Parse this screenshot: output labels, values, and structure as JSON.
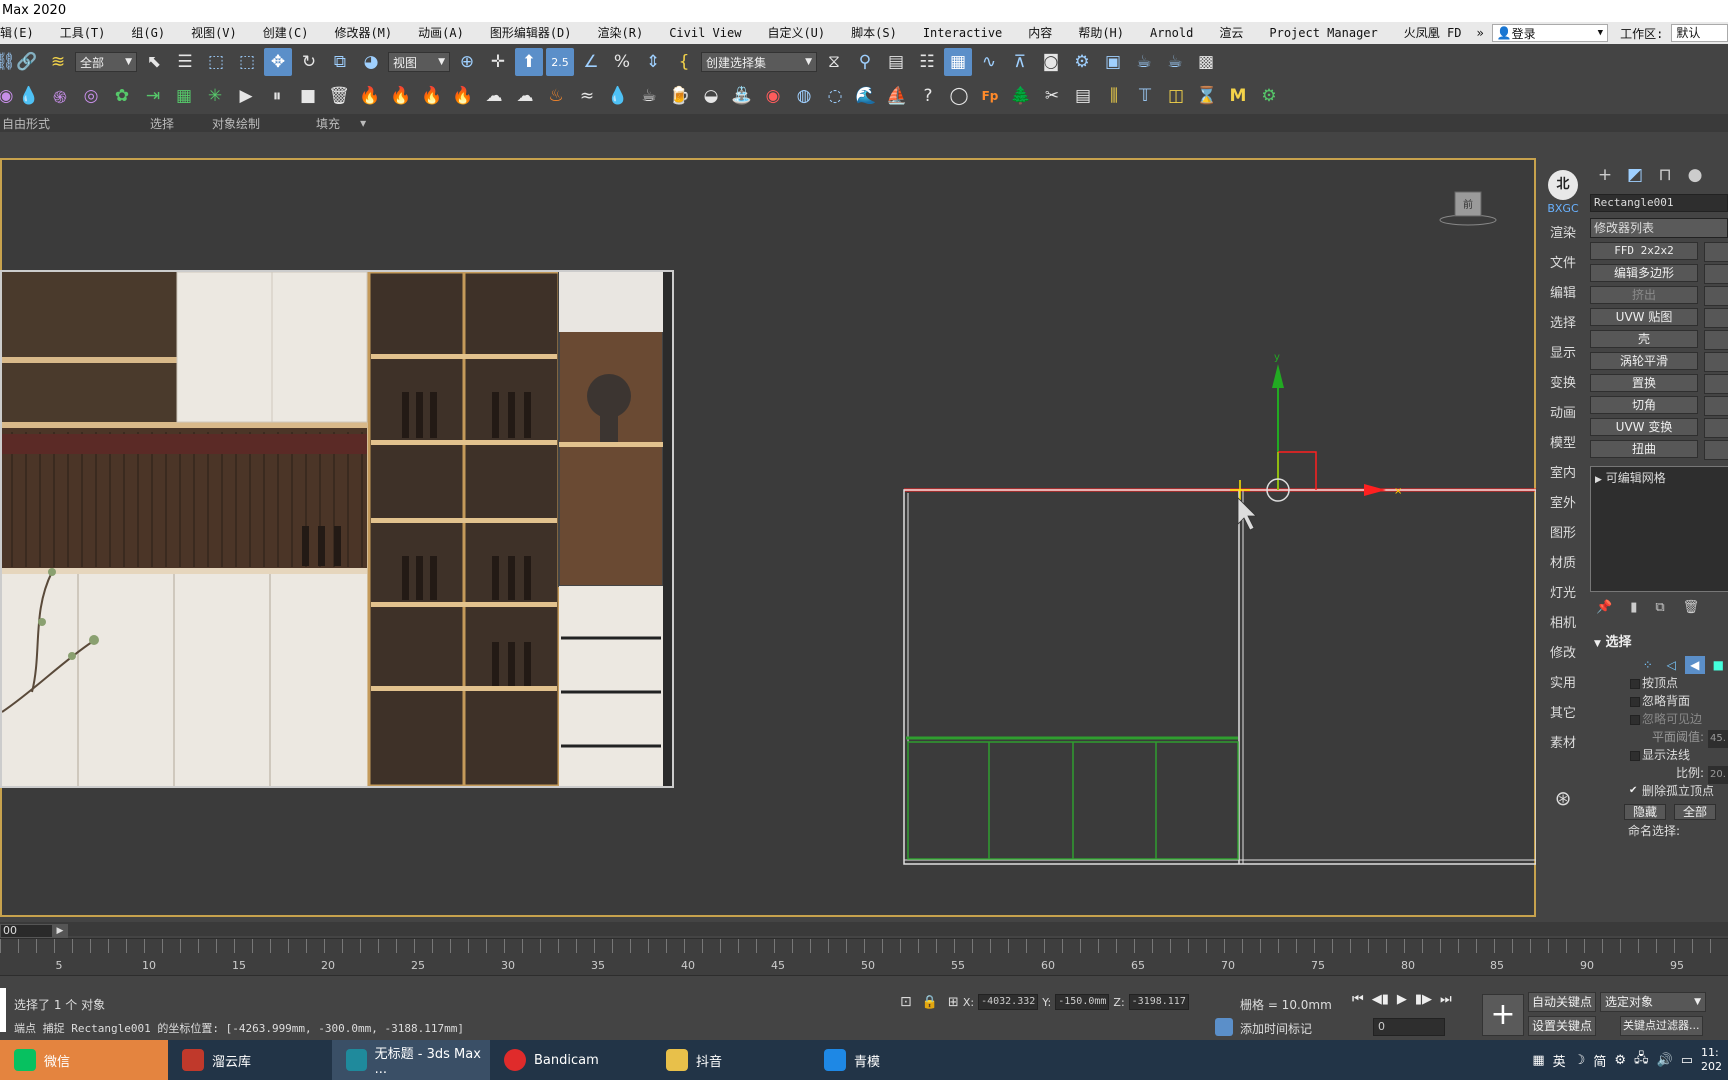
{
  "window": {
    "title": "Max 2020"
  },
  "menu": {
    "items": [
      "辑(E)",
      "工具(T)",
      "组(G)",
      "视图(V)",
      "创建(C)",
      "修改器(M)",
      "动画(A)",
      "图形编辑器(D)",
      "渲染(R)",
      "Civil View",
      "自定义(U)",
      "脚本(S)",
      "Interactive",
      "内容",
      "帮助(H)",
      "Arnold",
      "渲云",
      "Project Manager",
      "火凤凰 FD"
    ],
    "more": "»",
    "login": "登录",
    "workspace_label": "工作区:",
    "workspace_value": "默认"
  },
  "toolbar1": {
    "filter": "全部",
    "view": "视图",
    "snap_value": "2.5",
    "selection_set": "创建选择集"
  },
  "ribbon": {
    "tabs": [
      "自由形式",
      "选择",
      "对象绘制",
      "填充"
    ],
    "toggle": "▾"
  },
  "side": {
    "logo": "北",
    "logo_text": "BXGC",
    "items": [
      "渲染",
      "文件",
      "编辑",
      "选择",
      "显示",
      "变换",
      "动画",
      "模型",
      "室内",
      "室外",
      "图形",
      "材质",
      "灯光",
      "相机",
      "修改",
      "实用",
      "其它",
      "素材"
    ]
  },
  "panel": {
    "object_name": "Rectangle001",
    "modifier_list": "修改器列表",
    "modifiers": [
      "FFD 2x2x2",
      "编辑多边形",
      "挤出",
      "UVW 贴图",
      "壳",
      "涡轮平滑",
      "置换",
      "切角",
      "UVW 变换",
      "扭曲"
    ],
    "stack_item": "可编辑网格",
    "selection_title": "选择",
    "checks": [
      {
        "label": "按顶点",
        "checked": false,
        "dim": false
      },
      {
        "label": "忽略背面",
        "checked": false,
        "dim": false
      },
      {
        "label": "忽略可见边",
        "checked": false,
        "dim": true
      }
    ],
    "plane_thresh_label": "平面阈值:",
    "plane_thresh_value": "45.",
    "show_normals": "显示法线",
    "scale_label": "比例:",
    "scale_value": "20.",
    "delete_isolated": "删除孤立顶点",
    "hide_btn": "隐藏",
    "all_btn": "全部",
    "named_sel": "命名选择:"
  },
  "viewport": {
    "viewcube_label": "前"
  },
  "timeline": {
    "frame_field": "00",
    "ticks": [
      "5",
      "10",
      "15",
      "20",
      "25",
      "30",
      "35",
      "40",
      "45",
      "50",
      "55",
      "60",
      "65",
      "70",
      "75",
      "80",
      "85",
      "90",
      "95"
    ]
  },
  "status": {
    "selected": "选择了 1 个 对象",
    "prompt": "端点 捕捉 Rectangle001 的坐标位置: [-4263.999mm, -300.0mm, -3188.117mm]",
    "x": "-4032.332",
    "y": "-150.0mm",
    "z": "-3198.117",
    "grid": "栅格 = 10.0mm",
    "add_time_tag": "添加时间标记",
    "frame_value": "0",
    "auto_key": "自动关键点",
    "set_key": "设置关键点",
    "selected_obj": "选定对象",
    "key_filter": "关键点过滤器..."
  },
  "taskbar": {
    "items": [
      "微信",
      "溜云库",
      "无标题 - 3ds Max ...",
      "Bandicam",
      "抖音",
      "青模"
    ],
    "tray": [
      "英",
      "简"
    ],
    "time": "11:",
    "date": "202"
  },
  "colors": {
    "accent": "#5b8fc9",
    "viewport_border": "#c7a24d",
    "x_axis": "#ff2020",
    "y_axis": "#22aa22",
    "spline_green": "#2f9e2f"
  }
}
